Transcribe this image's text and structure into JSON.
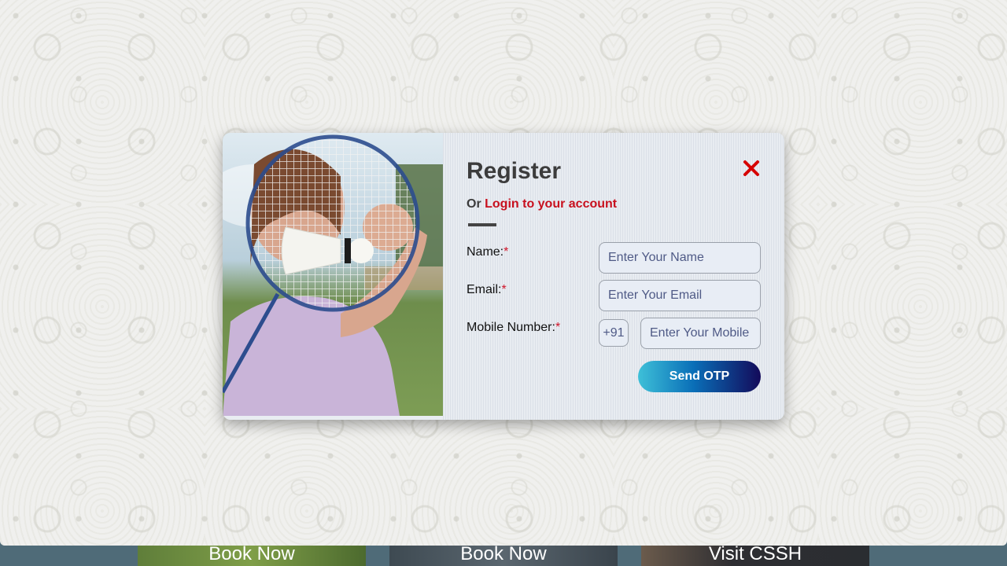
{
  "bottom_tiles": [
    {
      "label": "Book Now"
    },
    {
      "label": "Book Now"
    },
    {
      "label": "Visit CSSH"
    }
  ],
  "modal": {
    "title": "Register",
    "subtitle_prefix": "Or",
    "login_link": "Login to your account",
    "close_icon": "close-icon",
    "fields": {
      "name": {
        "label": "Name:",
        "required_mark": "*",
        "placeholder": "Enter Your Name",
        "value": ""
      },
      "email": {
        "label": "Email:",
        "required_mark": "*",
        "placeholder": "Enter Your Email",
        "value": ""
      },
      "mobile": {
        "label": "Mobile Number:",
        "required_mark": "*",
        "country_code": "+91",
        "placeholder": "Enter Your Mobile",
        "value": ""
      }
    },
    "submit_label": "Send OTP",
    "image": "badminton-player-image"
  },
  "colors": {
    "accent_red": "#c8101e",
    "button_gradient_start": "#3ec0d8",
    "button_gradient_end": "#130a5a"
  }
}
